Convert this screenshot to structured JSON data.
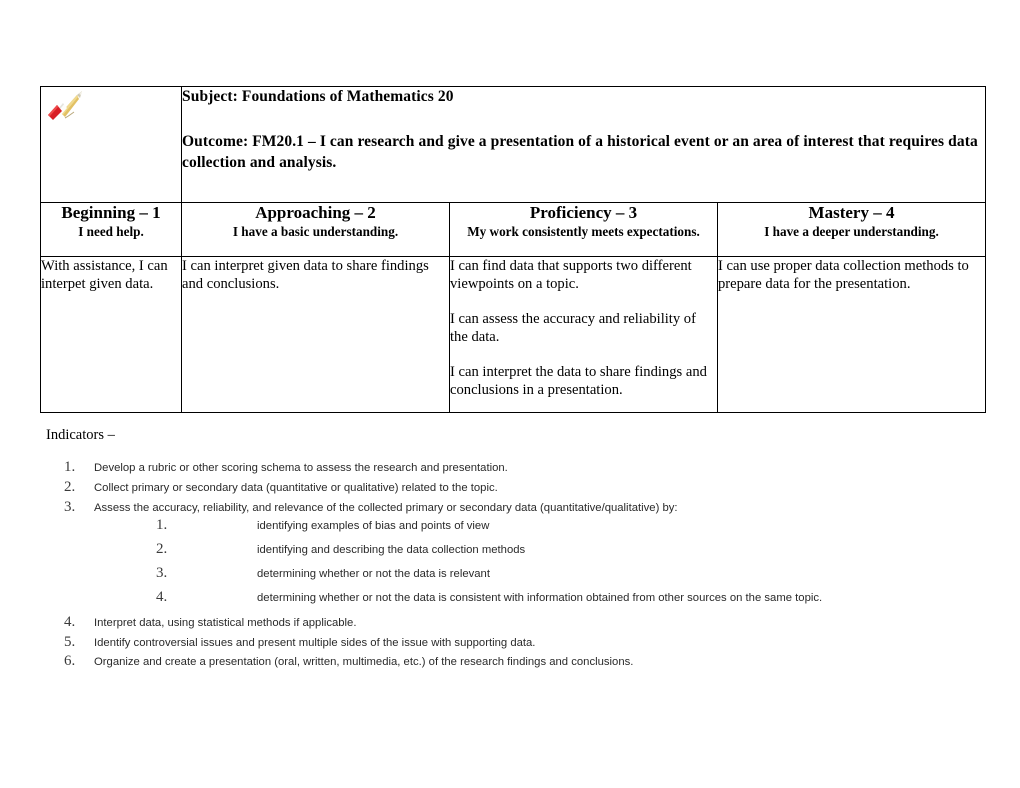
{
  "document": {
    "icon": "pencil-icon",
    "subject_line": "Subject: Foundations of Mathematics 20",
    "outcome_line": "Outcome: FM20.1 – I can research and give a presentation of a historical event or an area of interest that requires data collection and analysis.",
    "indicators_label": "Indicators –"
  },
  "rubric": {
    "levels": [
      {
        "title": "Beginning – 1",
        "subtitle": "I need help."
      },
      {
        "title": "Approaching – 2",
        "subtitle": "I have a basic understanding."
      },
      {
        "title": "Proficiency – 3",
        "subtitle": "My work consistently meets expectations."
      },
      {
        "title": "Mastery – 4",
        "subtitle": "I have a deeper understanding."
      }
    ],
    "descriptors": [
      {
        "paragraphs": [
          "With assistance, I can interpet given data."
        ]
      },
      {
        "paragraphs": [
          "I can interpret given data to share findings and conclusions."
        ]
      },
      {
        "paragraphs": [
          "I can find data that supports two different viewpoints on a topic.",
          "I can assess the accuracy and reliability of the data.",
          "I can interpret the data to share findings and conclusions in a presentation."
        ]
      },
      {
        "paragraphs": [
          "I can use proper data collection methods to prepare data for the presentation."
        ]
      }
    ]
  },
  "indicators": [
    {
      "num": "1.",
      "text": "Develop a rubric or other scoring schema to assess the research and presentation."
    },
    {
      "num": "2.",
      "text": "Collect primary or secondary data (quantitative or qualitative) related to the topic."
    },
    {
      "num": "3.",
      "text": "Assess the accuracy, reliability, and relevance of the collected primary or secondary data (quantitative/qualitative) by:",
      "subitems": [
        {
          "num": "1.",
          "text": "identifying examples of bias and points of view"
        },
        {
          "num": "2.",
          "text": "identifying and describing the data collection methods"
        },
        {
          "num": "3.",
          "text": "determining whether or not the data is relevant"
        },
        {
          "num": "4.",
          "text": "determining whether or not the data is consistent with information obtained from other sources on the same topic."
        }
      ]
    },
    {
      "num": "4.",
      "text": "Interpret data, using statistical methods if applicable."
    },
    {
      "num": "5.",
      "text": "Identify controversial issues and present multiple sides of the issue with supporting data."
    },
    {
      "num": "6.",
      "text": "Organize and create a presentation (oral, written, multimedia, etc.) of the research findings and conclusions."
    }
  ],
  "colors": {
    "pencil_body": "#e8c35a",
    "pencil_eraser": "#d81f26",
    "pencil_band": "#ffffff",
    "border": "#000000"
  }
}
